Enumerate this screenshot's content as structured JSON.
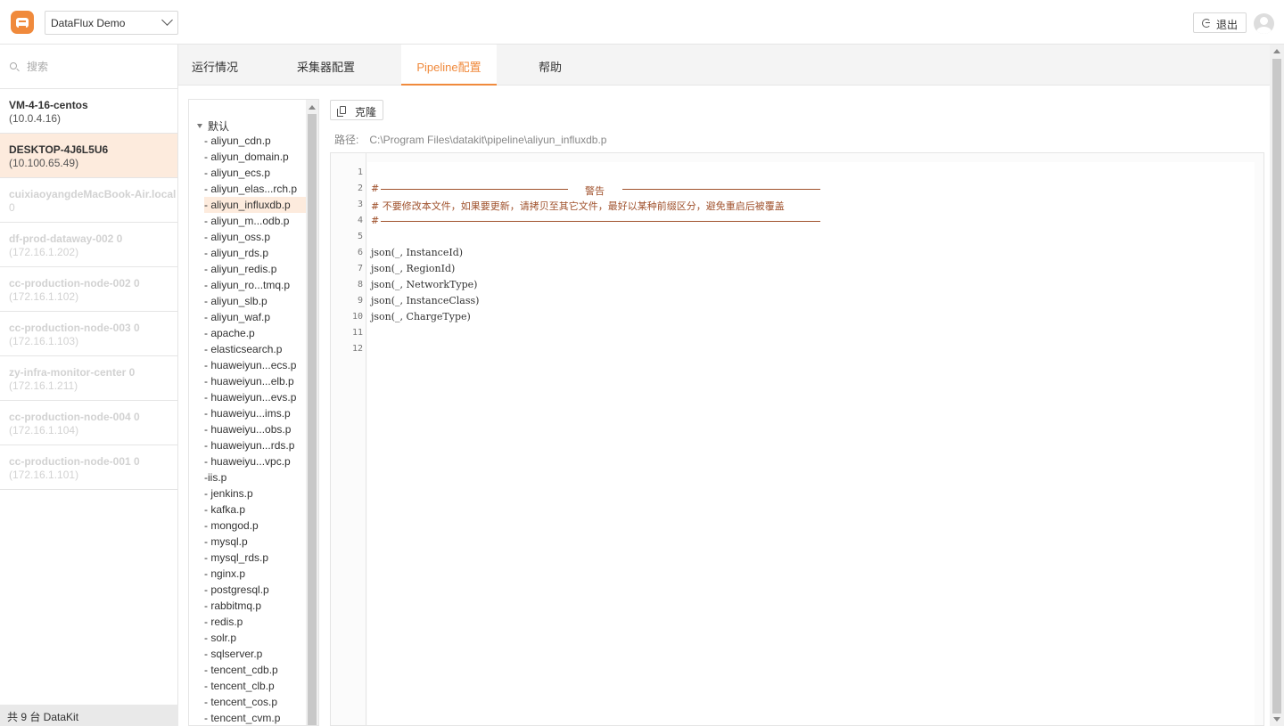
{
  "header": {
    "workspace": "DataFlux Demo",
    "logout_label": "退出"
  },
  "sidebar": {
    "search_placeholder": "搜索",
    "hosts": [
      {
        "name": "VM-4-16-centos",
        "ip": "(10.0.4.16)",
        "state": "online"
      },
      {
        "name": "DESKTOP-4J6L5U6",
        "ip": "(10.100.65.49)",
        "state": "active"
      },
      {
        "name": "cuixiaoyangdeMacBook-Air.local",
        "ip": "0",
        "state": "offline"
      },
      {
        "name": "df-prod-dataway-002 0",
        "ip": "(172.16.1.202)",
        "state": "offline"
      },
      {
        "name": "cc-production-node-002 0",
        "ip": "(172.16.1.102)",
        "state": "offline"
      },
      {
        "name": "cc-production-node-003 0",
        "ip": "(172.16.1.103)",
        "state": "offline"
      },
      {
        "name": "zy-infra-monitor-center 0",
        "ip": "(172.16.1.211)",
        "state": "offline"
      },
      {
        "name": "cc-production-node-004 0",
        "ip": "(172.16.1.104)",
        "state": "offline"
      },
      {
        "name": "cc-production-node-001 0",
        "ip": "(172.16.1.101)",
        "state": "offline"
      }
    ],
    "footer": "共 9 台 DataKit"
  },
  "tabs": [
    "运行情况",
    "采集器配置",
    "Pipeline配置",
    "帮助"
  ],
  "active_tab": "Pipeline配置",
  "tree": {
    "root": "默认",
    "items": [
      "- aliyun_cdn.p",
      "- aliyun_domain.p",
      "- aliyun_ecs.p",
      "- aliyun_elas...rch.p",
      "- aliyun_influxdb.p",
      "- aliyun_m...odb.p",
      "- aliyun_oss.p",
      "- aliyun_rds.p",
      "- aliyun_redis.p",
      "- aliyun_ro...tmq.p",
      "- aliyun_slb.p",
      "- aliyun_waf.p",
      "- apache.p",
      "- elasticsearch.p",
      "- huaweiyun...ecs.p",
      "- huaweiyun...elb.p",
      "- huaweiyun...evs.p",
      "- huaweiyu...ims.p",
      "- huaweiyu...obs.p",
      "- huaweiyun...rds.p",
      "- huaweiyu...vpc.p",
      "-iis.p",
      "- jenkins.p",
      "- kafka.p",
      "- mongod.p",
      "- mysql.p",
      "- mysql_rds.p",
      "- nginx.p",
      "- postgresql.p",
      "- rabbitmq.p",
      "- redis.p",
      "- solr.p",
      "- sqlserver.p",
      "- tencent_cdb.p",
      "- tencent_clb.p",
      "- tencent_cos.p",
      "- tencent_cvm.p"
    ],
    "selected": "- aliyun_influxdb.p"
  },
  "toolbar": {
    "clone_label": "克隆"
  },
  "path": {
    "label": "路径:",
    "value": "C:\\Program Files\\datakit\\pipeline\\aliyun_influxdb.p"
  },
  "editor": {
    "line_numbers": [
      "1",
      "2",
      "3",
      "4",
      "5",
      "6",
      "7",
      "8",
      "9",
      "10",
      "11",
      "12"
    ],
    "lines": [
      "",
      "#",
      "# 不要修改本文件，如果要更新，请拷贝至其它文件，最好以某种前缀区分，避免重启后被覆盖",
      "#",
      "",
      "json(_, InstanceId)",
      "json(_, RegionId)",
      "json(_, NetworkType)",
      "json(_, InstanceClass)",
      "json(_, ChargeType)",
      "",
      ""
    ],
    "warning_label": "警告"
  },
  "colors": {
    "accent": "#f08a3c",
    "active_bg": "#fdebdd",
    "comment": "#a0522d"
  }
}
